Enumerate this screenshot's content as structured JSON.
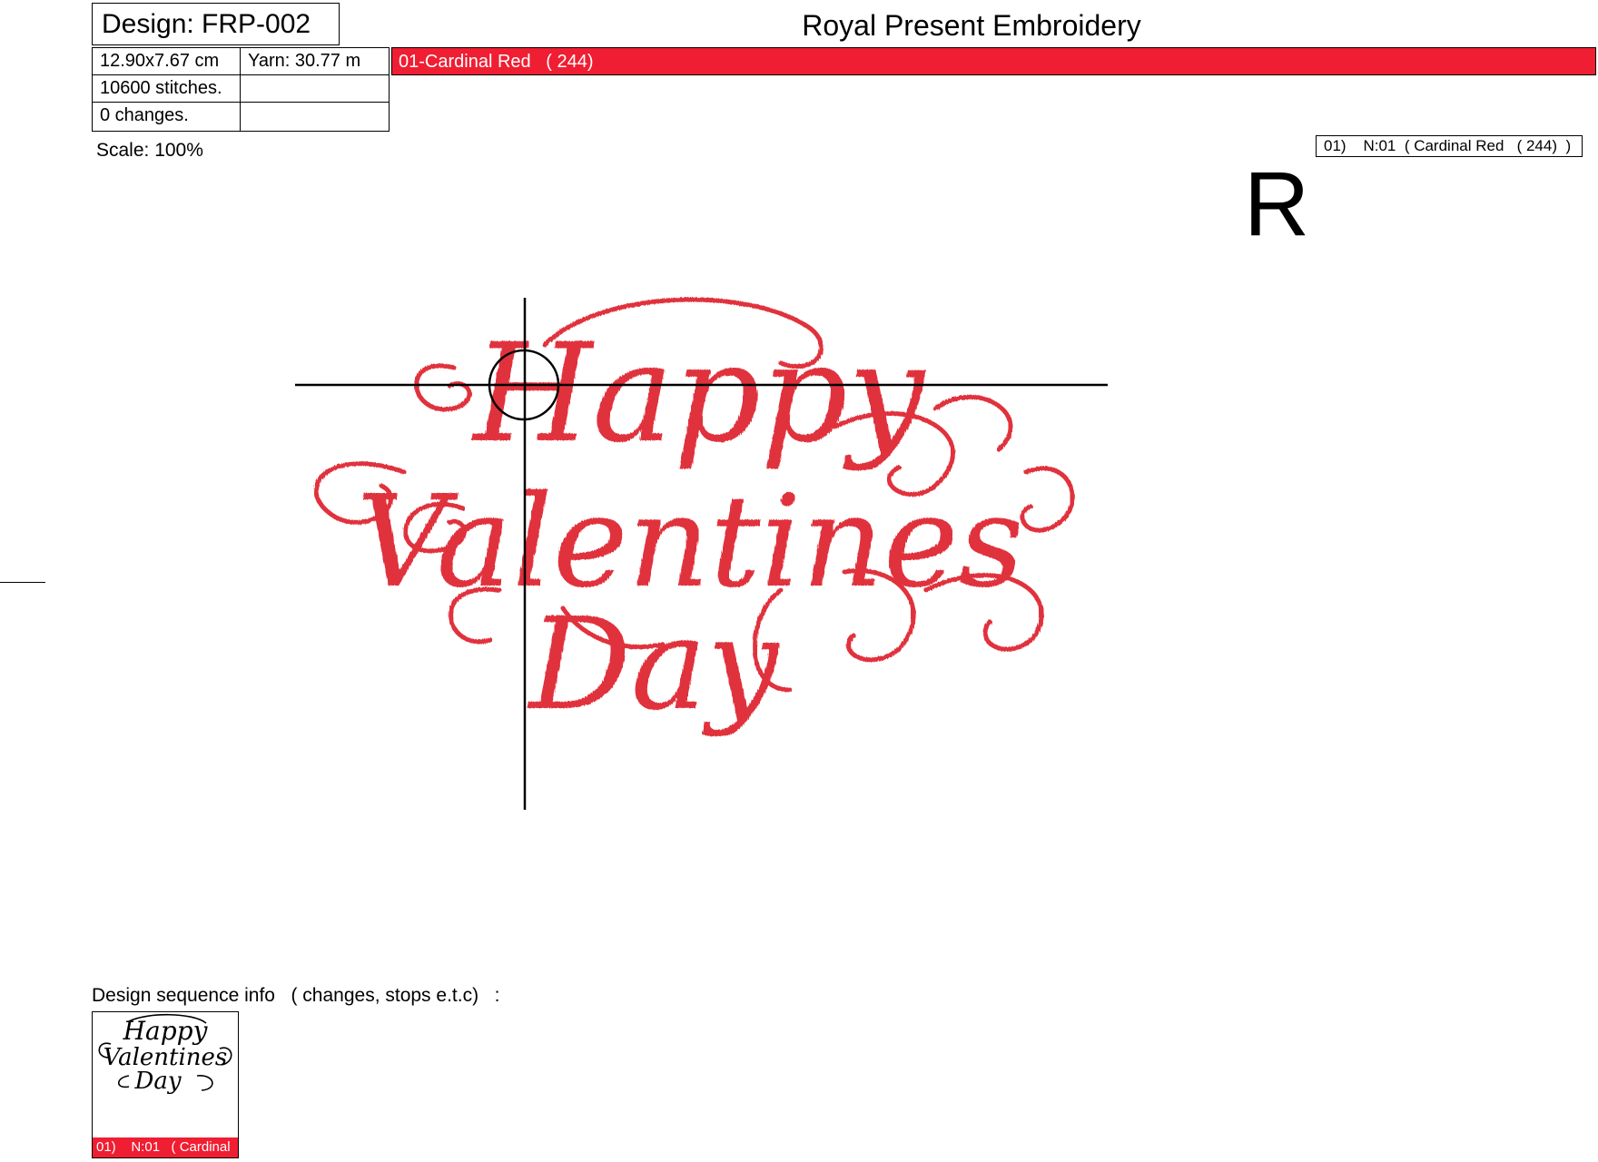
{
  "header": {
    "design_label": "Design: FRP-002",
    "brand": "Royal Present Embroidery"
  },
  "info": {
    "size": "12.90x7.67 cm",
    "yarn": "Yarn: 30.77 m",
    "stitches": "10600 stitches.",
    "changes": "0 changes."
  },
  "color_bar": {
    "label": "01-Cardinal Red   ( 244)",
    "color": "#f01e32"
  },
  "scale": "Scale: 100%",
  "needle_legend": "01)    N:01  ( Cardinal Red   ( 244)  )",
  "orientation_mark": "R",
  "design_text": {
    "line1": "Happy",
    "line2": "Valentines",
    "line3": "Day",
    "thread_color": "#e0303c"
  },
  "sequence": {
    "label": "Design sequence info   ( changes, stops e.t.c)   :",
    "thumb_label": "01)    N:01   ( Cardinal"
  }
}
